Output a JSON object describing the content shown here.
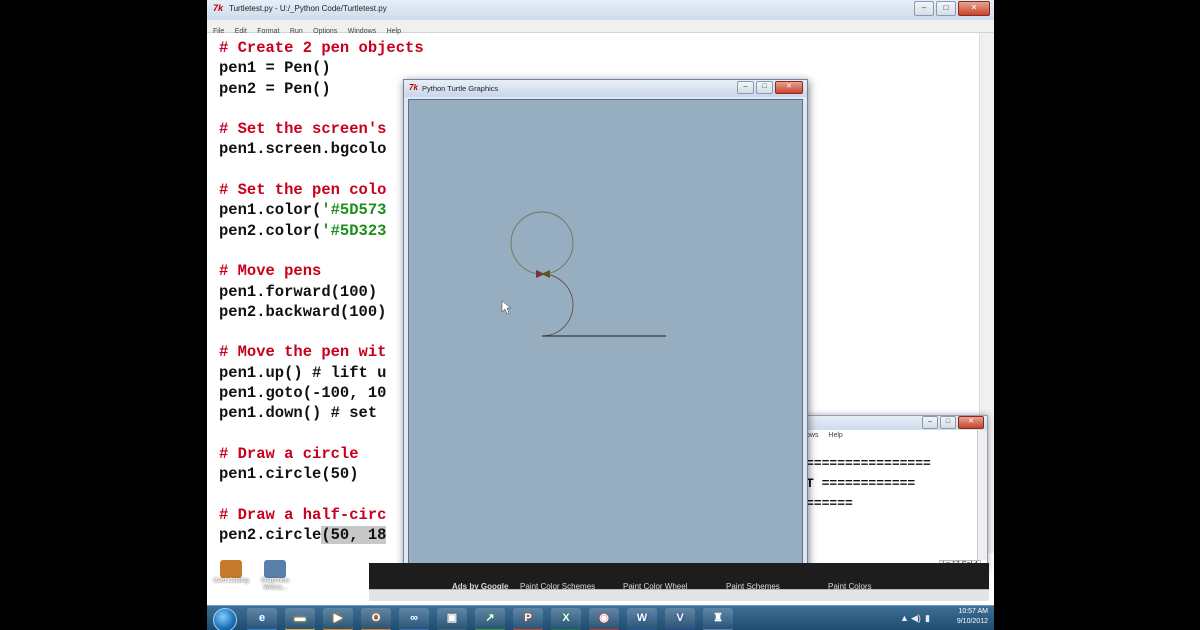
{
  "editor": {
    "title": "Turtletest.py - U:/_Python Code/Turtletest.py",
    "menus": [
      "File",
      "Edit",
      "Format",
      "Run",
      "Options",
      "Windows",
      "Help"
    ],
    "lines": {
      "l1": "# Create 2 pen objects",
      "l2": "pen1 = Pen()",
      "l3": "pen2 = Pen()",
      "l5": "# Set the screen's",
      "l6": "pen1.screen.bgcolo",
      "l8": "# Set the pen colo",
      "l9_code": "pen1.color(",
      "l9_str": "'#5D573",
      "l10_code": "pen2.color(",
      "l10_str": "'#5D323",
      "l12": "# Move pens",
      "l13": "pen1.forward(100)",
      "l14": "pen2.backward(100)",
      "l16": "# Move the pen wit",
      "l17": "pen1.up() # lift u",
      "l18": "pen1.goto(-100, 10",
      "l19": "pen1.down() # set ",
      "l21": "# Draw a circle",
      "l22": "pen1.circle(50)",
      "l24": "# Draw a half-circ",
      "l25_code": "pen2.circle",
      "l25_sel": "(50, 18"
    }
  },
  "turtle_window": {
    "title": "Python Turtle Graphics",
    "background_color": "#96aec0",
    "pen1_color": "#5D5730",
    "pen2_color": "#5D3230"
  },
  "shell": {
    "menus": [
      "ows",
      "Help"
    ],
    "output": [
      "================",
      "T ============",
      "======"
    ],
    "status": "Ln 17 Col 4"
  },
  "browser": {
    "links": [
      "Ads by Google",
      "Paint Color Schemes",
      "Paint Color Wheel",
      "Paint Schemes",
      "Paint Colors"
    ]
  },
  "desktop": {
    "icons": [
      {
        "label": "Card Catalog",
        "color": "#c77a2b"
      },
      {
        "label": "Snapshots Webca...",
        "color": "#5a7fa8"
      }
    ]
  },
  "taskbar": {
    "apps": [
      {
        "name": "ie-icon",
        "glyph": "e",
        "color": "#2f86d6"
      },
      {
        "name": "folder-icon",
        "glyph": "▬",
        "color": "#e0b23c"
      },
      {
        "name": "media-player-icon",
        "glyph": "▶",
        "color": "#e88a1a"
      },
      {
        "name": "outlook-icon",
        "glyph": "O",
        "color": "#e07a1f"
      },
      {
        "name": "link-icon",
        "glyph": "∞",
        "color": "#3a70b8"
      },
      {
        "name": "screen-icon",
        "glyph": "▣",
        "color": "#4a5c78"
      },
      {
        "name": "graph-icon",
        "glyph": "↗",
        "color": "#3f9a3f"
      },
      {
        "name": "powerpoint-icon",
        "glyph": "P",
        "color": "#d24726"
      },
      {
        "name": "excel-icon",
        "glyph": "X",
        "color": "#1f7a3a"
      },
      {
        "name": "record-icon",
        "glyph": "◉",
        "color": "#c0392b"
      },
      {
        "name": "word-icon",
        "glyph": "W",
        "color": "#2b579a"
      },
      {
        "name": "v-app-icon",
        "glyph": "V",
        "color": "#2a4a8a"
      },
      {
        "name": "python-icon",
        "glyph": "♜",
        "color": "#5c7fb0"
      }
    ],
    "clock_time": "10:57 AM",
    "clock_date": "9/10/2012"
  }
}
